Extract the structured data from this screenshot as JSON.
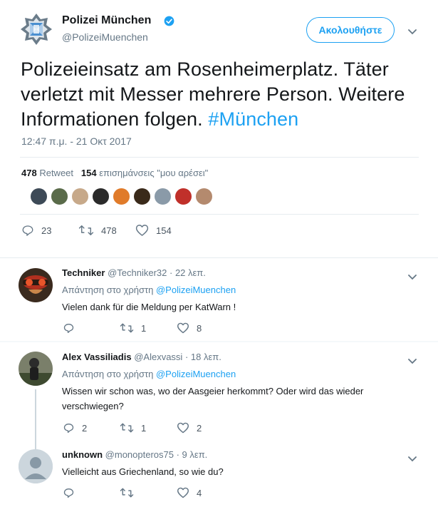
{
  "tweet": {
    "author_name": "Polizei München",
    "author_handle": "@PolizeiMuenchen",
    "follow_label": "Ακολουθήστε",
    "text": "Polizeieinsatz am Rosenheimerplatz. Täter verletzt mit Messer mehrere Person. Weitere Informationen folgen.",
    "hashtag": "#München",
    "timestamp": "12:47 π.μ. - 21 Οκτ 2017",
    "retweets_count": "478",
    "retweets_label": "Retweet",
    "likes_count": "154",
    "likes_label": "επισημάνσεις \"μου αρέσει\"",
    "actions": {
      "replies": "23",
      "retweets": "478",
      "likes": "154"
    }
  },
  "likers": [
    "#3d4a57",
    "#5a6b4a",
    "#c7a98a",
    "#2b2b2b",
    "#e07b2a",
    "#3a2a1a",
    "#8a9aa8",
    "#c0302a",
    "#b48a6e"
  ],
  "replies": [
    {
      "name": "Techniker",
      "handle": "@Techniker32",
      "time": "· 22 λεπ.",
      "reply_to_label": "Απάντηση στο χρήστη",
      "reply_to_handle": "@PolizeiMuenchen",
      "text": "Vielen dank für die Meldung per KatWarn !",
      "counts": {
        "replies": "",
        "retweets": "1",
        "likes": "8"
      }
    },
    {
      "name": "Alex Vassiliadis",
      "handle": "@Alexvassi",
      "time": "· 18 λεπ.",
      "reply_to_label": "Απάντηση στο χρήστη",
      "reply_to_handle": "@PolizeiMuenchen",
      "text": "Wissen wir schon was, wo der Aasgeier herkommt? Oder wird das wieder verschwiegen?",
      "counts": {
        "replies": "2",
        "retweets": "1",
        "likes": "2"
      }
    },
    {
      "name": "unknown",
      "handle": "@monopteros75",
      "time": "· 9 λεπ.",
      "text": "Vielleicht aus Griechenland, so wie du?",
      "counts": {
        "replies": "",
        "retweets": "",
        "likes": "4"
      }
    }
  ],
  "colors": {
    "accent": "#1da1f2",
    "muted": "#657786",
    "divider": "#e6ecf0"
  }
}
